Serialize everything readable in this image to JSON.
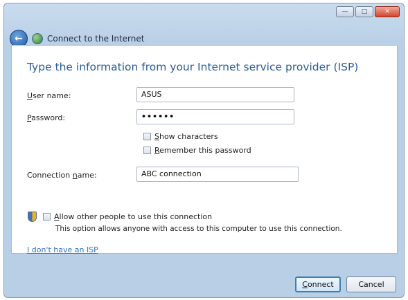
{
  "window": {
    "title": "Connect to the Internet",
    "controls": {
      "minimize": "—",
      "maximize": "□",
      "close": "✕"
    }
  },
  "form": {
    "heading": "Type the information from your Internet service provider (ISP)",
    "username": {
      "label_u": "U",
      "label_rest": "ser name:",
      "value": "ASUS"
    },
    "password": {
      "label_u": "P",
      "label_rest": "assword:",
      "value": "••••••"
    },
    "show_characters": {
      "label_u": "S",
      "label_rest": "how characters",
      "checked": false
    },
    "remember_password": {
      "label_u": "R",
      "label_rest": "emember this password",
      "checked": false
    },
    "connection_name": {
      "label_pre": "Connection ",
      "label_u": "n",
      "label_rest": "ame:",
      "value": "ABC connection"
    },
    "allow_others": {
      "label_u": "A",
      "label_rest": "llow other people to use this connection",
      "description": "This option allows anyone with access to this computer to use this connection.",
      "checked": false
    },
    "no_isp_link": "I don't have an ISP"
  },
  "buttons": {
    "connect": {
      "label_u": "C",
      "label_rest": "onnect"
    },
    "cancel": "Cancel"
  }
}
